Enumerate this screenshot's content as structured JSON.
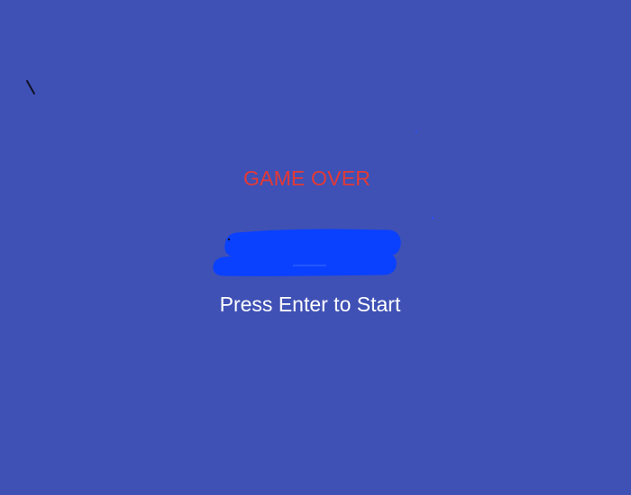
{
  "game": {
    "state": "game-over",
    "title": "GAME OVER",
    "prompt": "Press Enter to Start"
  },
  "colors": {
    "background": "#3f51b5",
    "title": "#e53935",
    "prompt": "#ffffff",
    "redaction": "#0a41ff",
    "stray_mark": "#1a1a2e"
  },
  "redacted_score": true
}
